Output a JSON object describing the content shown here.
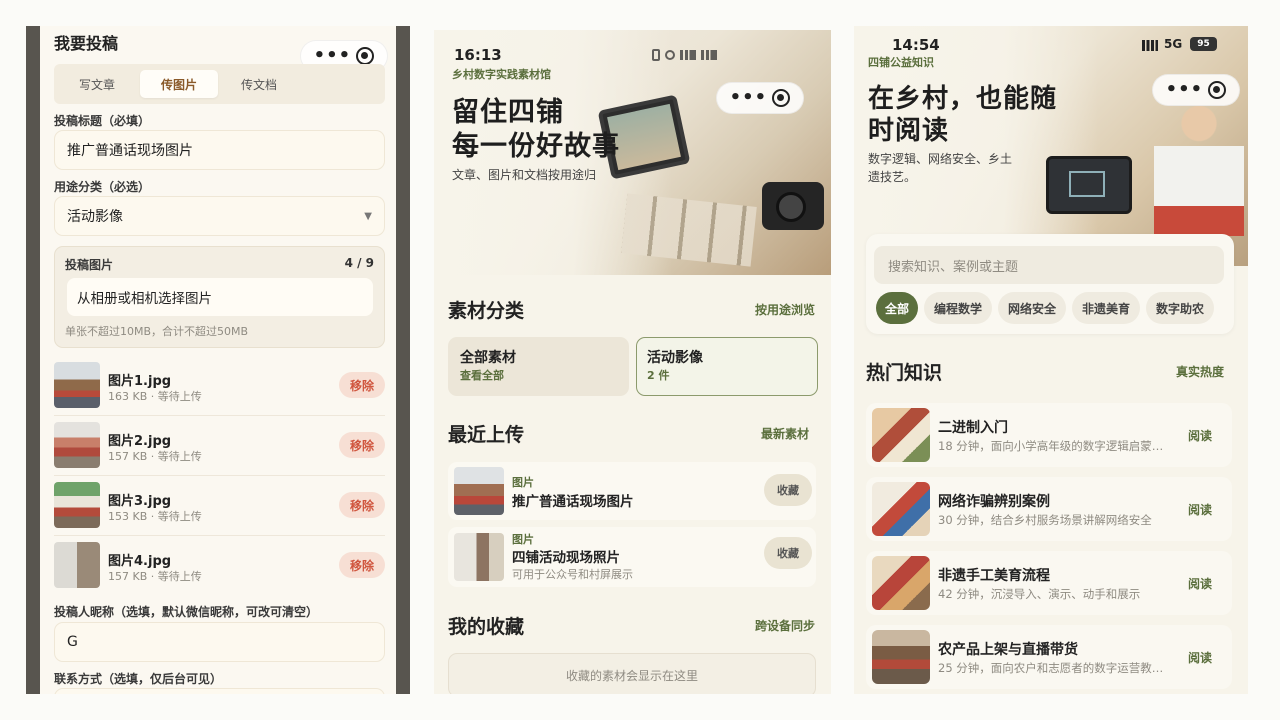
{
  "screen1": {
    "title": "我要投稿",
    "tabs": [
      "写文章",
      "传图片",
      "传文档"
    ],
    "title_label": "投稿标题（必填）",
    "title_value": "推广普通话现场图片",
    "category_label": "用途分类（必选）",
    "category_value": "活动影像",
    "images_label": "投稿图片",
    "images_count": "4 / 9",
    "pick_label": "从相册或相机选择图片",
    "limit_note": "单张不超过10MB，合计不超过50MB",
    "files": [
      {
        "name": "图片1.jpg",
        "meta": "163 KB · 等待上传",
        "remove": "移除"
      },
      {
        "name": "图片2.jpg",
        "meta": "157 KB · 等待上传",
        "remove": "移除"
      },
      {
        "name": "图片3.jpg",
        "meta": "153 KB · 等待上传",
        "remove": "移除"
      },
      {
        "name": "图片4.jpg",
        "meta": "157 KB · 等待上传",
        "remove": "移除"
      }
    ],
    "nickname_label": "投稿人昵称（选填，默认微信昵称，可改可清空）",
    "nickname_value": "G",
    "contact_label": "联系方式（选填，仅后台可见）"
  },
  "screen2": {
    "time": "16:13",
    "subtitle": "乡村数字实践素材馆",
    "hero_line1": "留住四铺",
    "hero_line2": "每一份好故事",
    "hero_desc": "文章、图片和文档按用途归",
    "section_category": "素材分类",
    "browse_link": "按用途浏览",
    "categories": [
      {
        "title": "全部素材",
        "sub": "查看全部"
      },
      {
        "title": "活动影像",
        "sub": "2 件"
      }
    ],
    "section_recent": "最近上传",
    "latest_link": "最新素材",
    "recent": [
      {
        "tag": "图片",
        "title": "推广普通话现场图片",
        "desc": "",
        "fav": "收藏"
      },
      {
        "tag": "图片",
        "title": "四铺活动现场照片",
        "desc": "可用于公众号和村屏展示",
        "fav": "收藏"
      }
    ],
    "section_fav": "我的收藏",
    "sync_link": "跨设备同步",
    "fav_placeholder": "收藏的素材会显示在这里"
  },
  "screen3": {
    "time": "14:54",
    "network": "5G",
    "battery": "95",
    "subtitle": "四铺公益知识",
    "hero_line1": "在乡村，也能随",
    "hero_line2": "时阅读",
    "hero_desc_1": "数字逻辑、网络安全、乡土",
    "hero_desc_2": "遗技艺。",
    "search_placeholder": "搜索知识、案例或主题",
    "chips": [
      "全部",
      "编程数学",
      "网络安全",
      "非遗美育",
      "数字助农"
    ],
    "section_hot": "热门知识",
    "heat_link": "真实热度",
    "articles": [
      {
        "title": "二进制入门",
        "desc": "18 分钟，面向小学高年级的数字逻辑启蒙…",
        "action": "阅读"
      },
      {
        "title": "网络诈骗辨别案例",
        "desc": "30 分钟，结合乡村服务场景讲解网络安全",
        "action": "阅读"
      },
      {
        "title": "非遗手工美育流程",
        "desc": "42 分钟，沉浸导入、演示、动手和展示",
        "action": "阅读"
      },
      {
        "title": "农产品上架与直播带货",
        "desc": "25 分钟，面向农户和志愿者的数字运营教…",
        "action": "阅读"
      }
    ]
  },
  "colors": {
    "accent_green": "#5b6f3d",
    "remove_red": "#d0563f",
    "cream": "#fbf8f1"
  }
}
